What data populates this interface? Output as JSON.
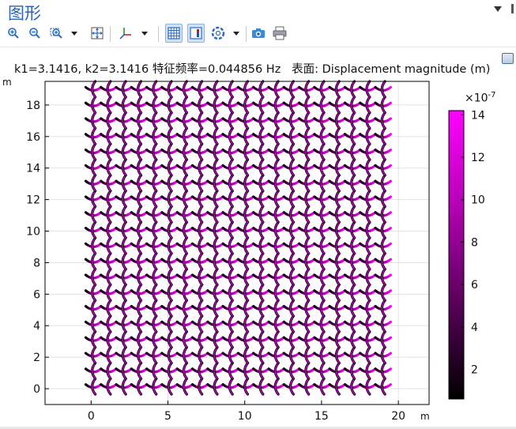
{
  "window": {
    "title": "图形"
  },
  "toolbar": {
    "buttons": [
      {
        "name": "zoom-in",
        "icon": "zoom-in-icon"
      },
      {
        "name": "zoom-out",
        "icon": "zoom-out-icon"
      },
      {
        "name": "zoom-box",
        "icon": "zoom-box-icon",
        "dropdown": true
      },
      {
        "name": "zoom-extents",
        "icon": "zoom-extents-icon"
      },
      {
        "name": "axis-orientation",
        "icon": "axis-icon",
        "dropdown": true
      },
      {
        "name": "show-grid",
        "icon": "grid-icon",
        "pressed": true
      },
      {
        "name": "show-legends",
        "icon": "legend-icon",
        "pressed": true
      },
      {
        "name": "color-scheme",
        "icon": "color-wheel-icon",
        "dropdown": true
      },
      {
        "name": "snapshot",
        "icon": "camera-icon"
      },
      {
        "name": "print",
        "icon": "printer-icon"
      }
    ]
  },
  "plot": {
    "title": "k1=3.1416, k2=3.1416 特征频率=0.044856 Hz   表面: Displacement magnitude (m)",
    "x_unit": "m",
    "y_unit": "m"
  },
  "chart_data": {
    "type": "heatmap",
    "description_kind": "surface plot of a periodic lattice",
    "x_ticks": [
      0,
      5,
      10,
      15,
      20
    ],
    "y_ticks": [
      0,
      2,
      4,
      6,
      8,
      10,
      12,
      14,
      16,
      18
    ],
    "xlim": [
      -3,
      22
    ],
    "ylim": [
      -1,
      19.5
    ],
    "lattice_cells_x": 20,
    "lattice_cells_y": 20,
    "grid": true,
    "colorbar": {
      "exponent": "×10",
      "exponent_power": "-7",
      "ticks": [
        2,
        4,
        6,
        8,
        10,
        12,
        14
      ],
      "range": [
        0.6,
        14.2
      ],
      "colors": [
        "#000000",
        "#5a005a",
        "#b400b4",
        "#ff00ff"
      ]
    },
    "colors": {
      "lattice_low": "#000000",
      "lattice_high": "#ff00ff",
      "axis": "#000000",
      "grid": "#e2e2e2"
    }
  }
}
